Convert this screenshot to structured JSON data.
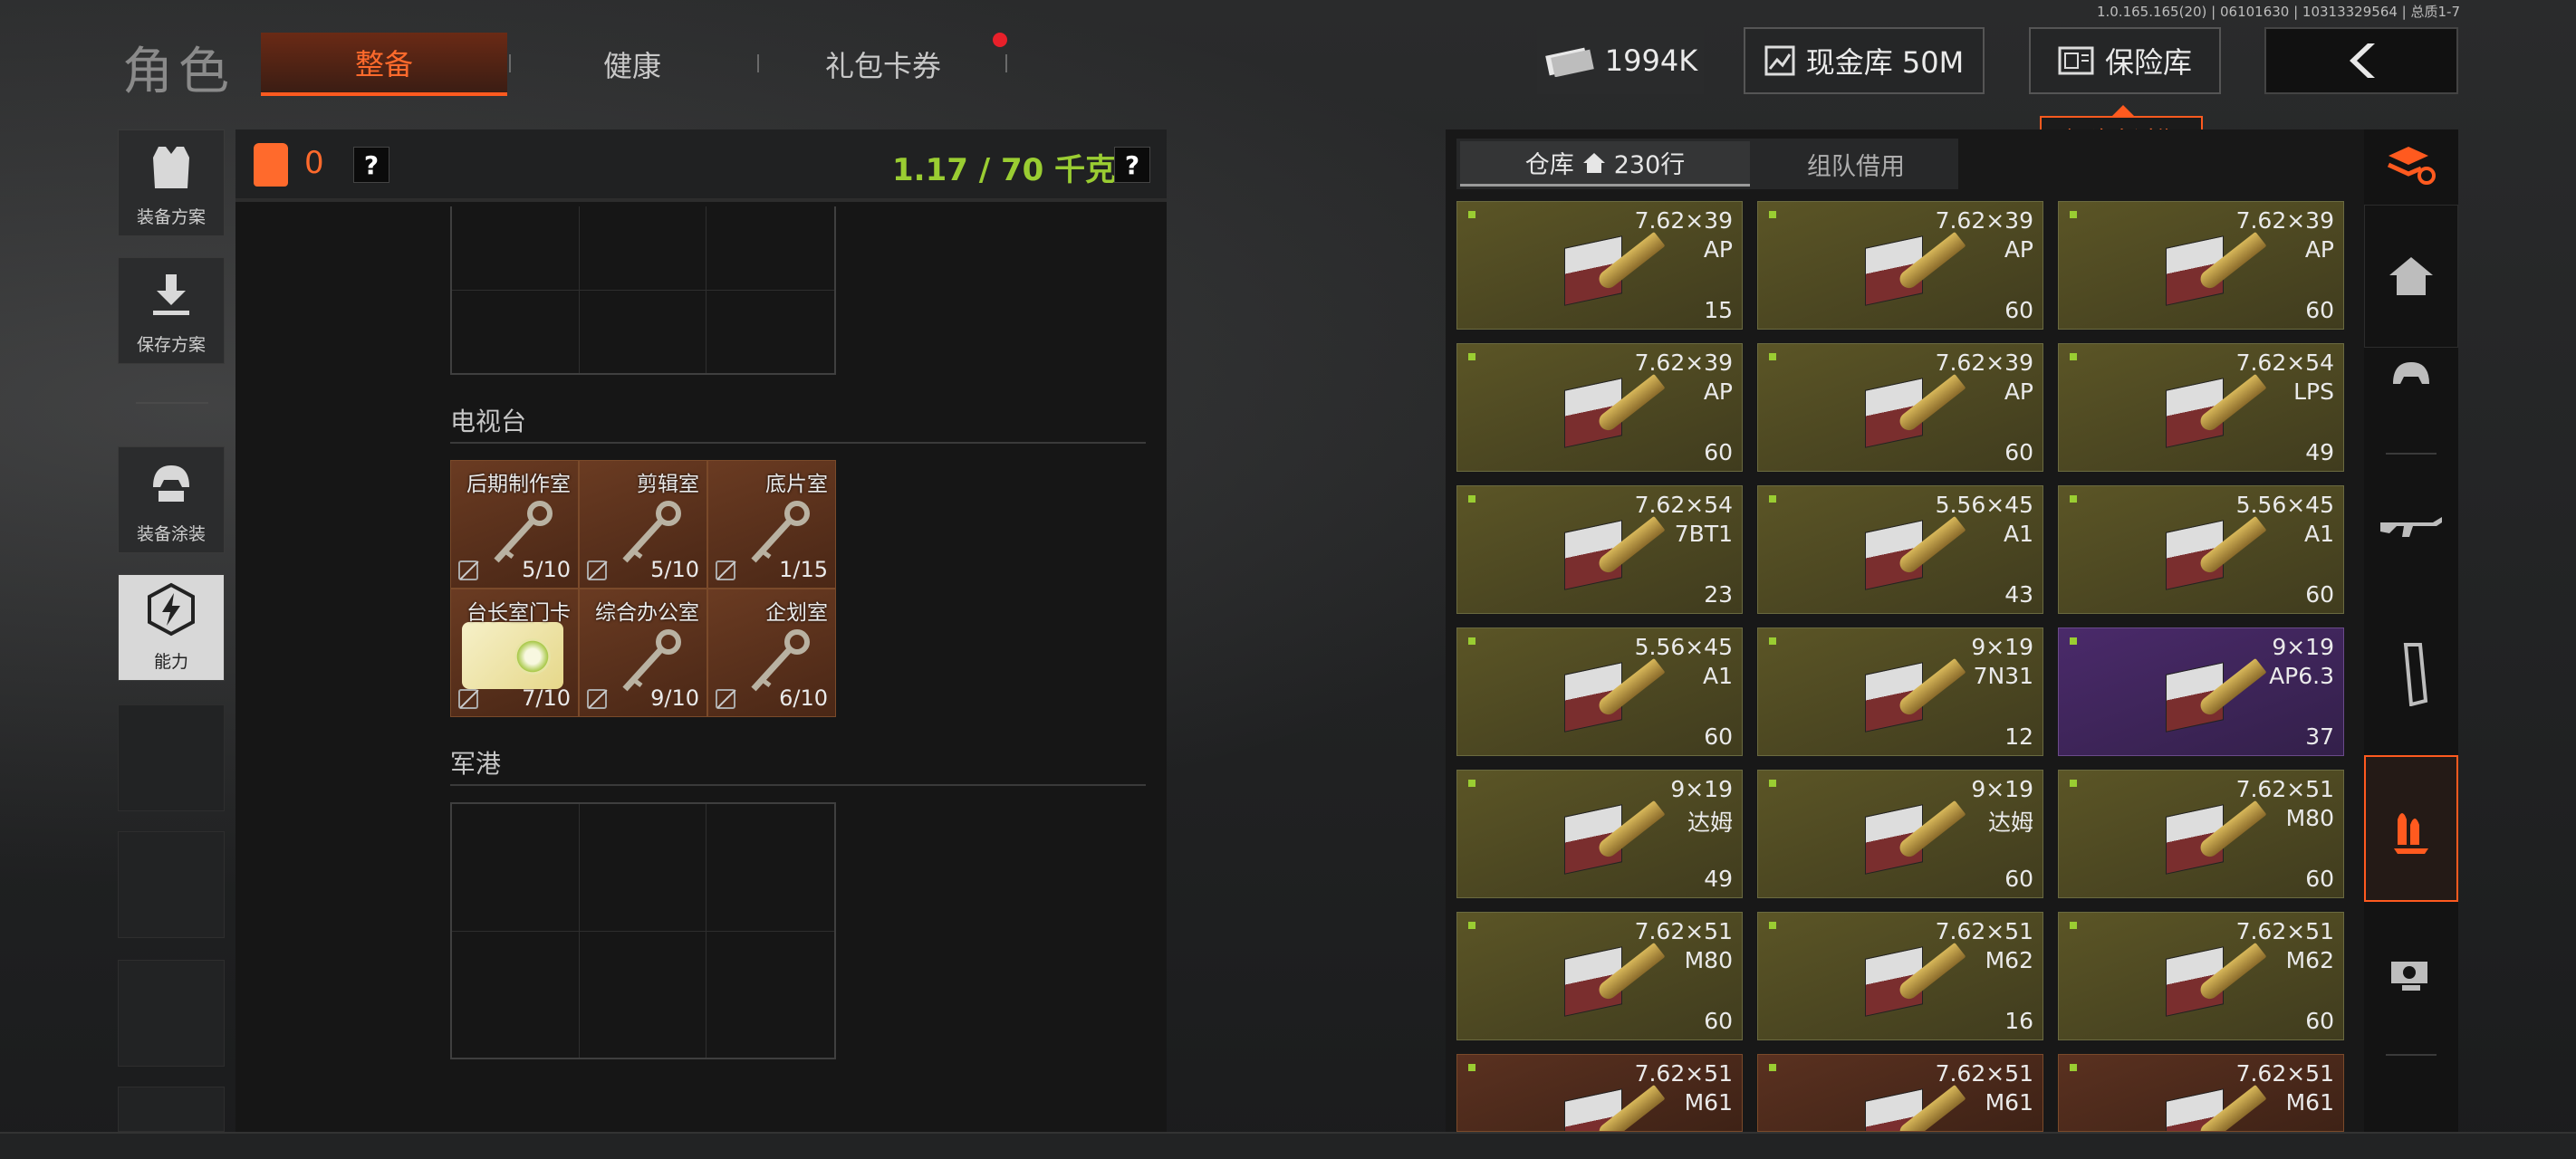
{
  "version": "1.0.165.165(20) | 06101630 | 10313329564 | 总质1-7",
  "header": {
    "title": "角色",
    "tabs": [
      {
        "label": "整备",
        "active": true
      },
      {
        "label": "健康",
        "active": false
      },
      {
        "label": "礼包卡券",
        "active": false,
        "notification": true
      }
    ],
    "money": "1994K",
    "cash_vault_label": "现金库 50M",
    "vault_label": "保险库",
    "vault_tip": "保险库过期",
    "back_icon": "chevron-left-icon"
  },
  "left_menu": [
    {
      "label": "装备方案",
      "icon": "vest-icon"
    },
    {
      "label": "保存方案",
      "icon": "download-icon"
    },
    {
      "label": "装备涂装",
      "icon": "helmet-icon"
    },
    {
      "label": "能力",
      "icon": "lightning-icon",
      "active": true
    }
  ],
  "loadout": {
    "vest_count": "0",
    "weight": "1.17 / 70 千克",
    "help": "?"
  },
  "sections": [
    {
      "title": "电视台",
      "keys": [
        {
          "name": "后期制作室",
          "count": "5/10",
          "kind": "key"
        },
        {
          "name": "剪辑室",
          "count": "5/10",
          "kind": "key"
        },
        {
          "name": "底片室",
          "count": "1/15",
          "kind": "key"
        },
        {
          "name": "台长室门卡",
          "count": "7/10",
          "kind": "card"
        },
        {
          "name": "综合办公室",
          "count": "9/10",
          "kind": "key"
        },
        {
          "name": "企划室",
          "count": "6/10",
          "kind": "key"
        }
      ]
    },
    {
      "title": "军港",
      "keys": []
    }
  ],
  "storage": {
    "tab_store": "仓库",
    "tab_store_rows": "230行",
    "tab_team": "组队借用",
    "items": [
      {
        "caliber": "7.62×39",
        "type": "AP",
        "qty": "15",
        "rarity": "olive"
      },
      {
        "caliber": "7.62×39",
        "type": "AP",
        "qty": "60",
        "rarity": "olive"
      },
      {
        "caliber": "7.62×39",
        "type": "AP",
        "qty": "60",
        "rarity": "olive"
      },
      {
        "caliber": "7.62×39",
        "type": "AP",
        "qty": "60",
        "rarity": "olive"
      },
      {
        "caliber": "7.62×39",
        "type": "AP",
        "qty": "60",
        "rarity": "olive"
      },
      {
        "caliber": "7.62×54",
        "type": "LPS",
        "qty": "49",
        "rarity": "olive"
      },
      {
        "caliber": "7.62×54",
        "type": "7BT1",
        "qty": "23",
        "rarity": "olive"
      },
      {
        "caliber": "5.56×45",
        "type": "A1",
        "qty": "43",
        "rarity": "olive"
      },
      {
        "caliber": "5.56×45",
        "type": "A1",
        "qty": "60",
        "rarity": "olive"
      },
      {
        "caliber": "5.56×45",
        "type": "A1",
        "qty": "60",
        "rarity": "olive"
      },
      {
        "caliber": "9×19",
        "type": "7N31",
        "qty": "12",
        "rarity": "olive"
      },
      {
        "caliber": "9×19",
        "type": "AP6.3",
        "qty": "37",
        "rarity": "purple"
      },
      {
        "caliber": "9×19",
        "type": "达姆",
        "qty": "49",
        "rarity": "olive"
      },
      {
        "caliber": "9×19",
        "type": "达姆",
        "qty": "60",
        "rarity": "olive"
      },
      {
        "caliber": "7.62×51",
        "type": "M80",
        "qty": "60",
        "rarity": "olive"
      },
      {
        "caliber": "7.62×51",
        "type": "M80",
        "qty": "60",
        "rarity": "olive"
      },
      {
        "caliber": "7.62×51",
        "type": "M62",
        "qty": "16",
        "rarity": "olive"
      },
      {
        "caliber": "7.62×51",
        "type": "M62",
        "qty": "60",
        "rarity": "olive"
      },
      {
        "caliber": "7.62×51",
        "type": "M61",
        "qty": "",
        "rarity": "brown"
      },
      {
        "caliber": "7.62×51",
        "type": "M61",
        "qty": "",
        "rarity": "brown"
      },
      {
        "caliber": "7.62×51",
        "type": "M61",
        "qty": "",
        "rarity": "brown"
      }
    ]
  },
  "right_icons": [
    {
      "icon": "stack-refresh-icon",
      "active": false
    },
    {
      "icon": "home-icon",
      "active": false
    },
    {
      "icon": "helmet-icon",
      "active": false
    },
    {
      "icon": "rifle-icon",
      "active": false
    },
    {
      "icon": "magazine-icon",
      "active": false
    },
    {
      "icon": "ammo-icon",
      "active": true
    },
    {
      "icon": "scope-icon",
      "active": false
    }
  ],
  "colors": {
    "accent": "#ff5a1f",
    "weight_green": "#9acd32",
    "olive_item": "#5b5526",
    "purple_item": "#4a2a6a",
    "brown_item": "#5a3120"
  }
}
